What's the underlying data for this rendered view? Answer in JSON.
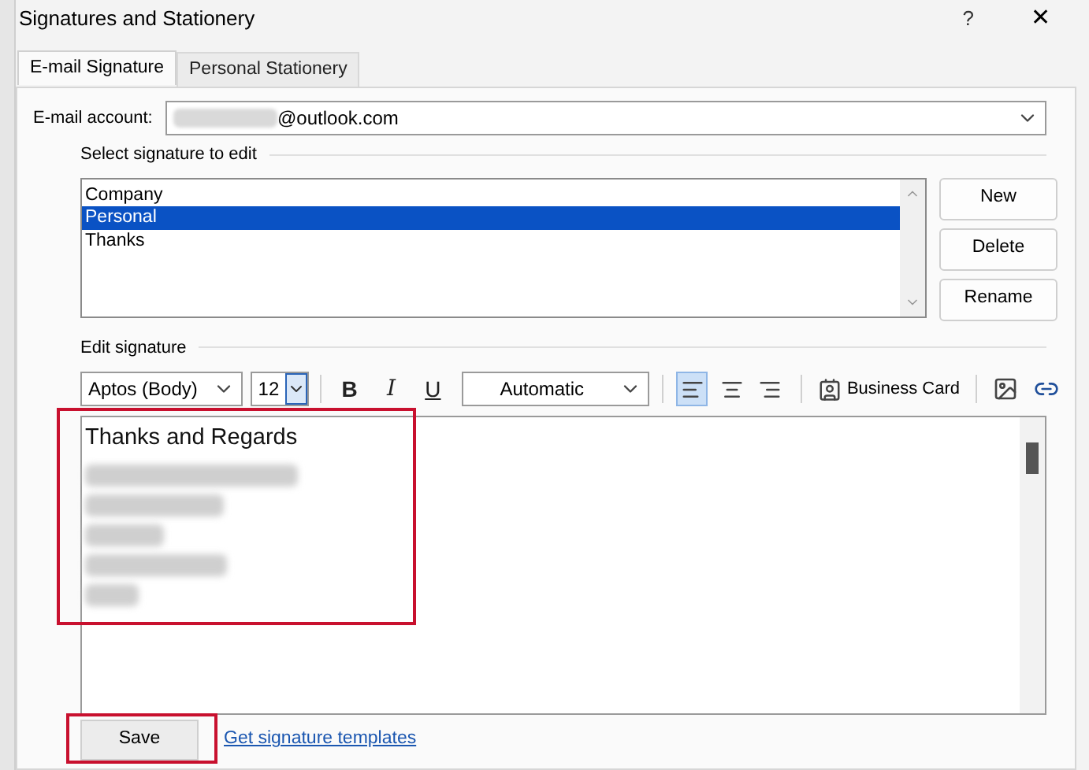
{
  "window": {
    "title": "Signatures and Stationery",
    "help": "?",
    "close": "✕"
  },
  "tabs": [
    {
      "label": "E-mail Signature",
      "selected": true
    },
    {
      "label": "Personal Stationery",
      "selected": false
    }
  ],
  "account": {
    "label": "E-mail account:",
    "value": "@outlook.com"
  },
  "signatures": {
    "label": "Select signature to edit",
    "items": [
      {
        "label": "Company",
        "selected": false
      },
      {
        "label": "Personal",
        "selected": true
      },
      {
        "label": "Thanks",
        "selected": false
      }
    ]
  },
  "buttons": [
    "New",
    "Delete",
    "Rename"
  ],
  "editor": {
    "label": "Edit signature",
    "font": "Aptos (Body)",
    "size": "12",
    "color_mode": "Automatic",
    "business_card": "Business Card",
    "formatting": [
      {
        "label": "B",
        "kind": "bold"
      },
      {
        "label": "I",
        "kind": "italic"
      },
      {
        "label": "U",
        "kind": "underline"
      }
    ],
    "alignment": [
      {
        "kind": "left",
        "selected": true
      },
      {
        "kind": "center",
        "selected": false
      },
      {
        "kind": "right",
        "selected": false
      }
    ],
    "first_line": "Thanks and Regards"
  },
  "save": "Save",
  "templates_link": "Get signature templates"
}
